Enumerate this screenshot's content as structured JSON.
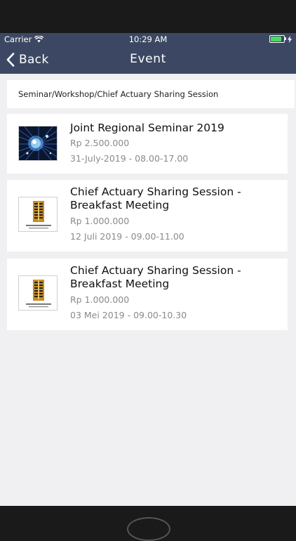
{
  "status_bar": {
    "carrier": "Carrier",
    "time": "10:29 AM",
    "battery_level": 0.85,
    "battery_color": "#4cd964"
  },
  "nav": {
    "back_label": "Back",
    "title": "Event",
    "bar_color": "#3c4863"
  },
  "breadcrumb": "Seminar/Workshop/Chief Actuary Sharing Session",
  "events": [
    {
      "title": "Joint Regional Seminar 2019",
      "price": "Rp 2.500.000",
      "date": "31-July-2019 - 08.00-17.00",
      "thumbnail": "network-tech-image"
    },
    {
      "title": "Chief Actuary Sharing Session - Breakfast Meeting",
      "price": "Rp 1.000.000",
      "date": "12 Juli 2019 - 09.00-11.00",
      "thumbnail": "association-logo"
    },
    {
      "title": "Chief Actuary Sharing Session - Breakfast Meeting",
      "price": "Rp 1.000.000",
      "date": "03 Mei 2019 - 09.00-10.30",
      "thumbnail": "association-logo"
    }
  ]
}
